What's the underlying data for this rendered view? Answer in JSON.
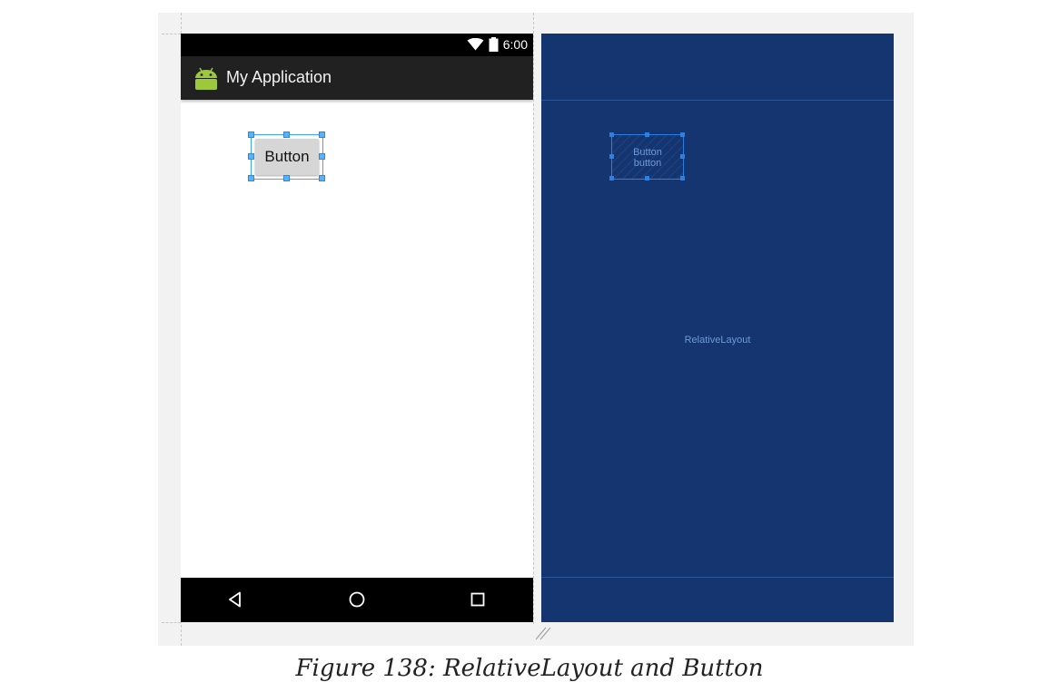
{
  "phone": {
    "status_bar": {
      "time": "6:00"
    },
    "action_bar": {
      "title": "My Application",
      "icon": "android-icon"
    },
    "button_label": "Button",
    "nav_bar": {
      "icons": [
        "back-triangle-icon",
        "home-circle-icon",
        "recents-square-icon"
      ]
    }
  },
  "blueprint": {
    "button_text": "Button",
    "button_id": "button",
    "layout_label": "RelativeLayout"
  },
  "caption": "Figure 138: RelativeLayout and Button",
  "colors": {
    "blueprint_bg": "#14356f",
    "selection": "#3fa2ff",
    "action_bar": "#212121",
    "android_green": "#9ec83c"
  }
}
